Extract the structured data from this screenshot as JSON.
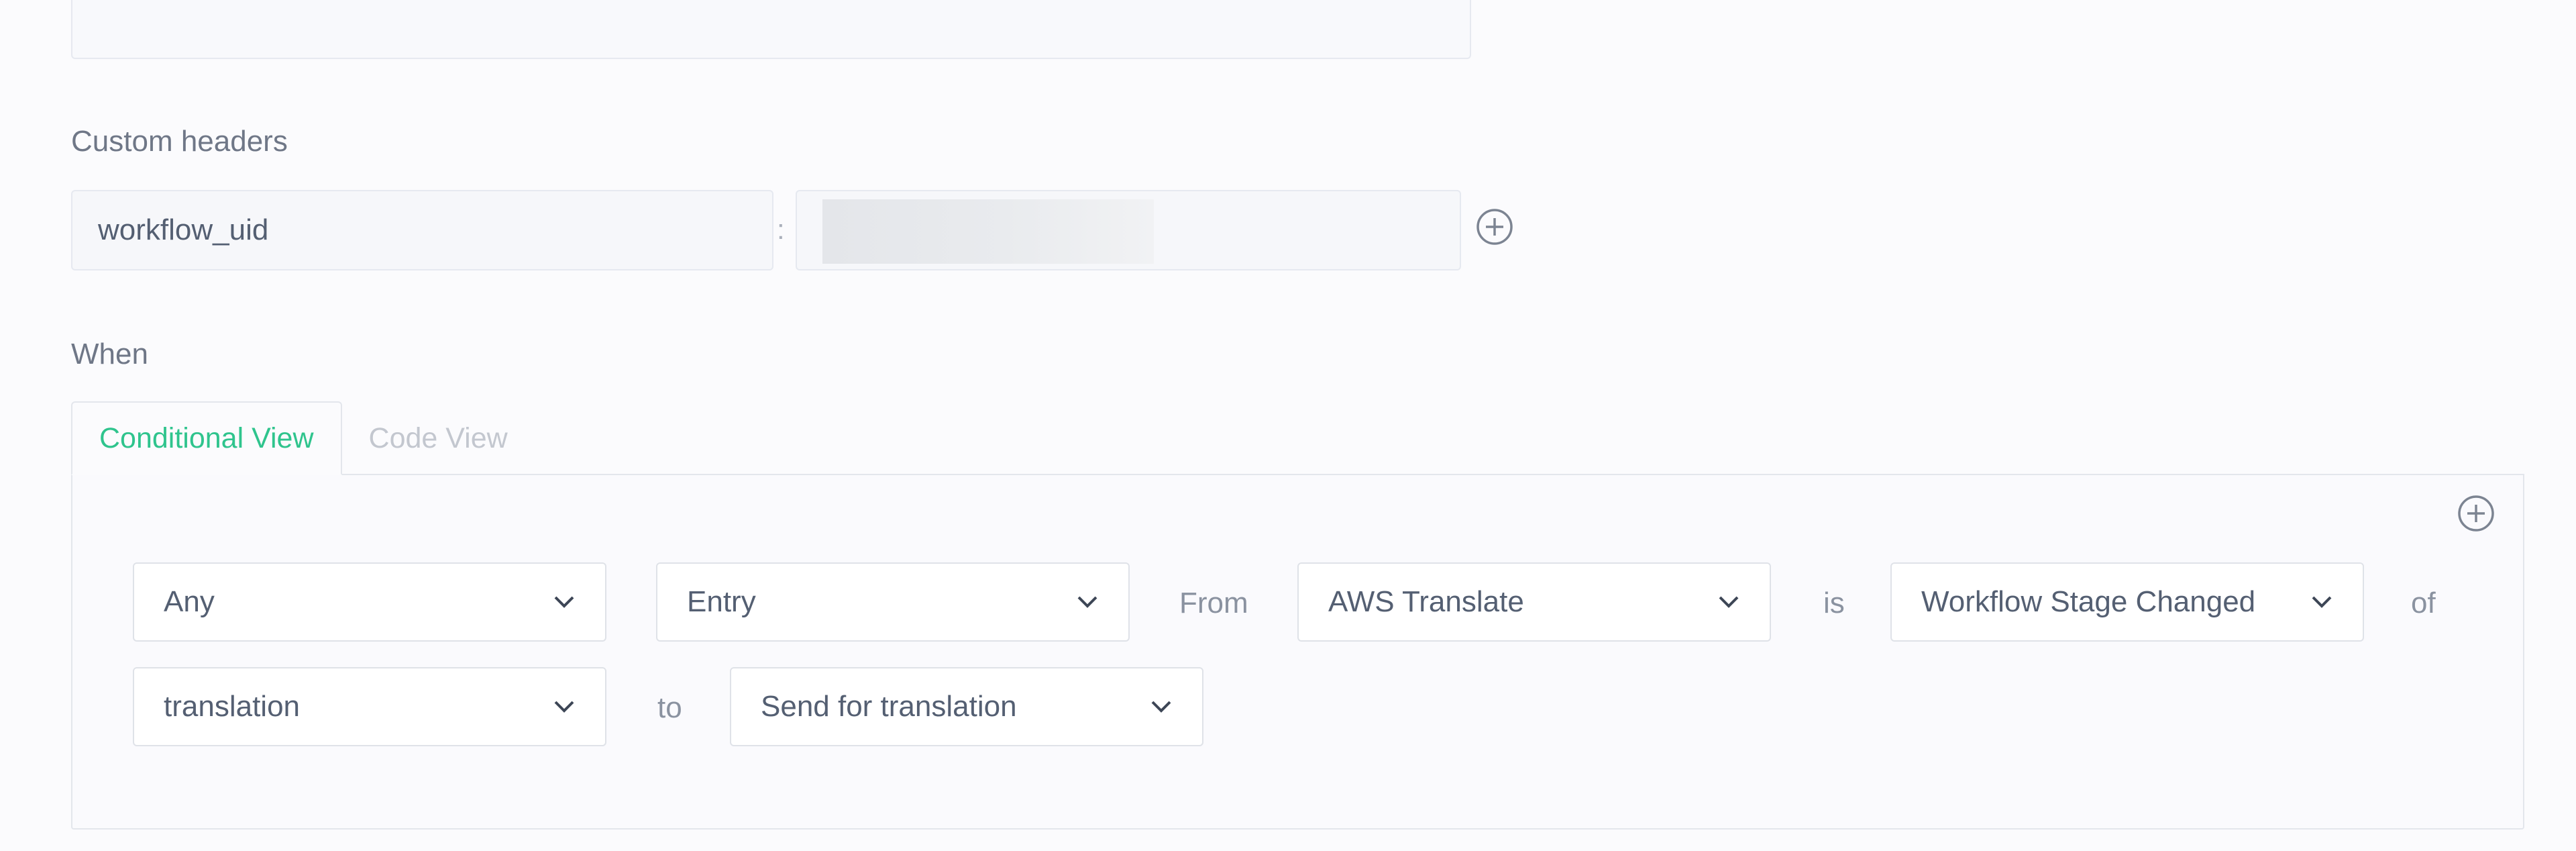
{
  "sections": {
    "custom_headers_label": "Custom headers",
    "when_label": "When"
  },
  "custom_header": {
    "key": "workflow_uid",
    "separator": ":"
  },
  "tabs": [
    {
      "label": "Conditional View",
      "active": true
    },
    {
      "label": "Code View",
      "active": false
    }
  ],
  "condition": {
    "scope": "Any",
    "content_type": "Entry",
    "from_word": "From",
    "source": "AWS Translate",
    "is_word": "is",
    "event": "Workflow Stage Changed",
    "of_word": "of",
    "workflow": "translation",
    "to_word": "to",
    "stage": "Send for translation"
  },
  "icons": {
    "add_header": "plus-circle-icon",
    "add_condition": "plus-circle-icon",
    "dropdown": "chevron-down-icon"
  },
  "colors": {
    "accent": "#2fc48d",
    "text": "#545f72",
    "muted": "#8a92a0",
    "border": "#dfe2e8"
  }
}
